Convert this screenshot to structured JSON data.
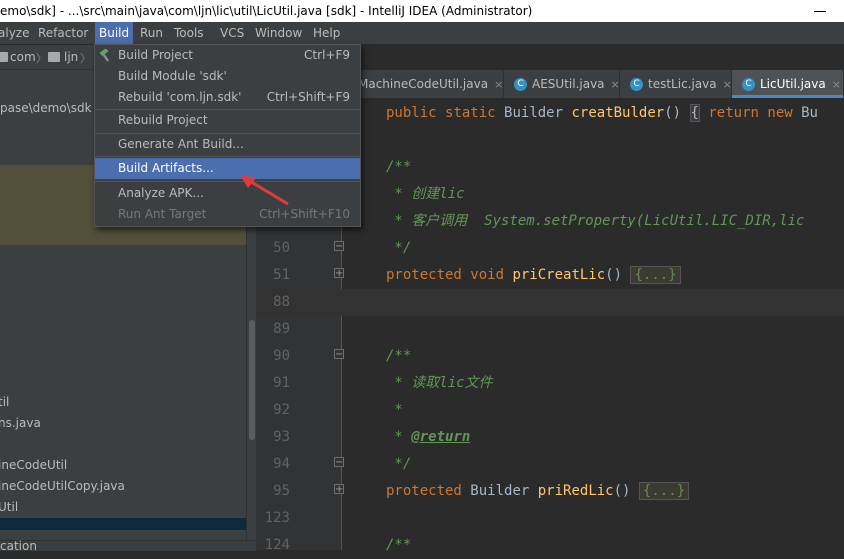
{
  "window": {
    "title": "emo\\sdk] - ...\\src\\main\\java\\com\\ljn\\lic\\util\\LicUtil.java [sdk] - IntelliJ IDEA (Administrator)"
  },
  "menubar": {
    "items": [
      "alyze",
      "Refactor",
      "Build",
      "Run",
      "Tools",
      "VCS",
      "Window",
      "Help"
    ],
    "active": "Build"
  },
  "breadcrumb": {
    "items": [
      "com",
      "ljn"
    ]
  },
  "build_menu": {
    "items": [
      {
        "label": "Build Project",
        "shortcut": "Ctrl+F9",
        "icon": "hammer-icon"
      },
      {
        "label": "Build Module 'sdk'",
        "shortcut": ""
      },
      {
        "label": "Rebuild 'com.ljn.sdk'",
        "shortcut": "Ctrl+Shift+F9"
      },
      {
        "label": "Rebuild Project",
        "shortcut": ""
      },
      {
        "label": "Generate Ant Build...",
        "shortcut": ""
      },
      {
        "label": "Build Artifacts...",
        "shortcut": ""
      },
      {
        "label": "Analyze APK...",
        "shortcut": ""
      },
      {
        "label": "Run Ant Target",
        "shortcut": "Ctrl+Shift+F10"
      }
    ],
    "selected": "Build Artifacts...",
    "disabled": [
      "Run Ant Target"
    ]
  },
  "project_panel": {
    "path_text": "pase\\demo\\sdk",
    "rows": [
      "til",
      "ns.java",
      "ineCodeUtil",
      "ineCodeUtilCopy.java",
      "Util",
      "cation"
    ]
  },
  "editor_tabs": [
    {
      "label": "MachineCodeUtil.java",
      "active": false
    },
    {
      "label": "AESUtil.java",
      "active": false,
      "icon": "C"
    },
    {
      "label": "testLic.java",
      "active": false,
      "icon": "C"
    },
    {
      "label": "LicUtil.java",
      "active": true,
      "icon": "C"
    }
  ],
  "code": {
    "line_numbers": [
      "50",
      "51",
      "88",
      "89",
      "90",
      "91",
      "92",
      "93",
      "94",
      "95",
      "123",
      "124"
    ],
    "line1_keywords": [
      "public",
      "static"
    ],
    "line1_type": "Builder",
    "line1_method": "creatBulder",
    "line1_parens": "()",
    "line1_brace": "{",
    "line1_return": "return",
    "line1_new": "new",
    "line1_tail": "Bu",
    "jdoc_open": "/**",
    "comment_create": " * 创建lic",
    "comment_client": " * 客户调用  System.setProperty(LicUtil.LIC_DIR,lic",
    "jdoc_close": " */",
    "protected": "protected",
    "void": "void",
    "m1": "priCreatLic",
    "parens": "()",
    "folded": "{...}",
    "comment_read": " * 读取lic文件",
    "star": " *",
    "return_tag": "@return",
    "builder": "Builder",
    "m2": "priRedLic"
  },
  "colors": {
    "menu_selected": "#4b6eaf",
    "keyword": "#cc7832",
    "method": "#ffc66d",
    "comment": "#629755",
    "arrow": "#e03c3c"
  }
}
